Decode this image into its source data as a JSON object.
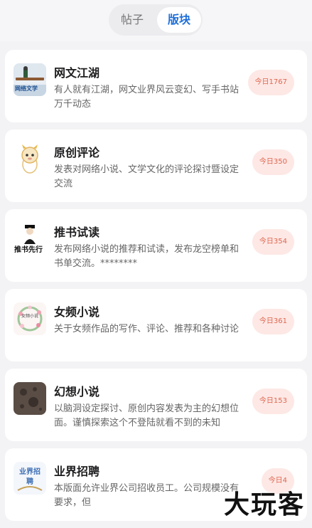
{
  "tabs": {
    "posts": "帖子",
    "boards": "版块"
  },
  "boards": [
    {
      "title": "网文江湖",
      "desc": "有人就有江湖，网文业界风云变幻、写手书站万千动态",
      "badge": "今日1767",
      "icon": "landscape-logo-icon",
      "icon_text": "网络文学"
    },
    {
      "title": "原创评论",
      "desc": "发表对网络小说、文学文化的评论探讨暨设定交流",
      "badge": "今日350",
      "icon": "dragon-mascot-icon",
      "icon_text": ""
    },
    {
      "title": "推书试读",
      "desc": "发布网络小说的推荐和试读，发布龙空榜单和书单交流。********",
      "badge": "今日354",
      "icon": "scholar-calligraphy-icon",
      "icon_text": "推书先行"
    },
    {
      "title": "女频小说",
      "desc": "关于女频作品的写作、评论、推荐和各种讨论",
      "badge": "今日361",
      "icon": "floral-wreath-icon",
      "icon_text": "女频小说"
    },
    {
      "title": "幻想小说",
      "desc": "以脑洞设定探讨、原创内容发表为主的幻想位面。谨慎探索这个不登陆就看不到的未知",
      "badge": "今日153",
      "icon": "moon-surface-icon",
      "icon_text": ""
    },
    {
      "title": "业界招聘",
      "desc": "本版面允许业界公司招收员工。公司规模没有要求，但",
      "badge": "今日4",
      "icon": "recruit-logo-icon",
      "icon_text": "业界招聘"
    }
  ],
  "watermark": "大玩客"
}
